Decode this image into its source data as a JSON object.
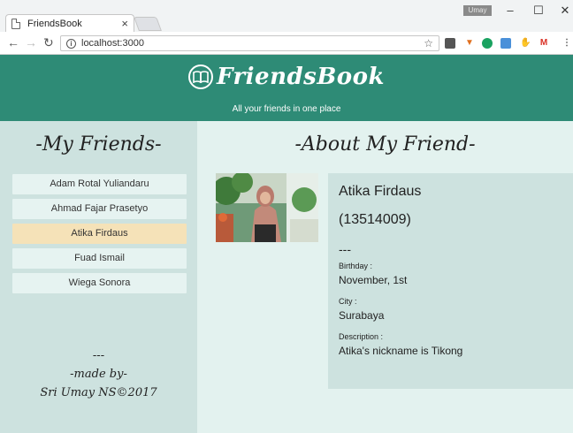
{
  "browser": {
    "tab_title": "FriendsBook",
    "tab_close": "×",
    "url": "localhost:3000",
    "user_badge": "Umay",
    "minimize": "–",
    "maximize": "☐",
    "close": "✕",
    "info_glyph": "i"
  },
  "header": {
    "brand": "FriendsBook",
    "tagline": "All your friends in one place"
  },
  "sidebar": {
    "title": "-My Friends-",
    "friends": [
      {
        "name": "Adam Rotal Yuliandaru",
        "active": false
      },
      {
        "name": "Ahmad Fajar Prasetyo",
        "active": false
      },
      {
        "name": "Atika Firdaus",
        "active": true
      },
      {
        "name": "Fuad Ismail",
        "active": false
      },
      {
        "name": "Wiega Sonora",
        "active": false
      }
    ],
    "credits": {
      "separator": "---",
      "made_by": "-made by-",
      "author": "Sri Umay NS©2017"
    }
  },
  "main": {
    "title": "-About My Friend-",
    "friend": {
      "name": "Atika Firdaus",
      "id": "(13514009)",
      "separator": "---",
      "birthday_label": "Birthday :",
      "birthday": "November, 1st",
      "city_label": "City :",
      "city": "Surabaya",
      "description_label": "Description :",
      "description": "Atika's nickname is Tikong"
    }
  },
  "colors": {
    "header": "#2e8b76",
    "sidebar": "#cde2df",
    "page": "#e3f2ef",
    "active_item": "#f5e2b8"
  }
}
